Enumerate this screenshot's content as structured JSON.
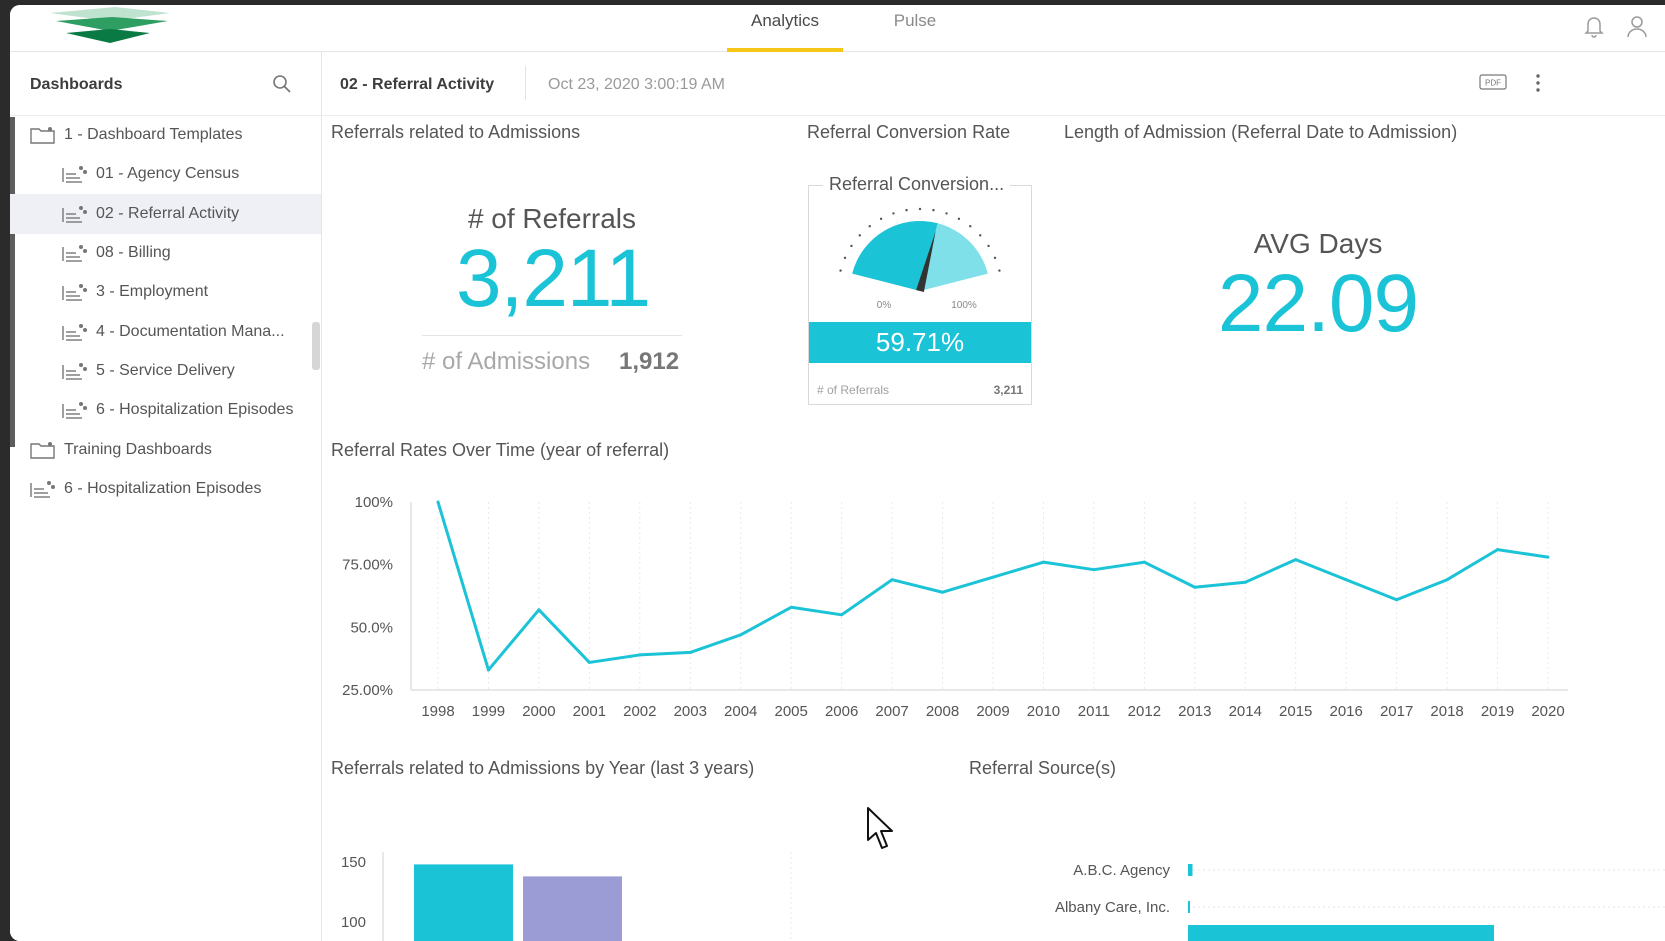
{
  "nav": {
    "tabs": [
      {
        "label": "Analytics",
        "active": true
      },
      {
        "label": "Pulse",
        "active": false
      }
    ]
  },
  "sidebar": {
    "title": "Dashboards",
    "items": [
      {
        "label": "1 - Dashboard Templates",
        "type": "folder",
        "level": 0
      },
      {
        "label": "01 - Agency Census",
        "type": "dashboard",
        "level": 1
      },
      {
        "label": "02 - Referral Activity",
        "type": "dashboard",
        "level": 1,
        "selected": true
      },
      {
        "label": "08 - Billing",
        "type": "dashboard",
        "level": 1
      },
      {
        "label": "3 - Employment",
        "type": "dashboard",
        "level": 1
      },
      {
        "label": "4 - Documentation Mana...",
        "type": "dashboard",
        "level": 1
      },
      {
        "label": "5 - Service Delivery",
        "type": "dashboard",
        "level": 1
      },
      {
        "label": "6 - Hospitalization Episodes",
        "type": "dashboard",
        "level": 1
      },
      {
        "label": "Training Dashboards",
        "type": "folder",
        "level": 0
      },
      {
        "label": "6 - Hospitalization Episodes",
        "type": "dashboard",
        "level": 0
      }
    ]
  },
  "dashboard": {
    "title": "02 - Referral Activity",
    "timestamp": "Oct 23, 2020 3:00:19 AM",
    "pdf_label": "PDF"
  },
  "widgets": {
    "referrals_title": "Referrals related to Admissions",
    "referrals_caption": "# of Referrals",
    "referrals_value": "3,211",
    "admissions_caption": "# of Admissions",
    "admissions_value": "1,912",
    "conversion_title": "Referral Conversion Rate",
    "gauge_title": "Referral Conversion...",
    "gauge_min": "0%",
    "gauge_max": "100%",
    "gauge_value": "59.71%",
    "gauge_fraction": 0.5971,
    "gauge_foot_label": "# of Referrals",
    "gauge_foot_value": "3,211",
    "length_title": "Length of Admission (Referral Date to Admission)",
    "avg_caption": "AVG Days",
    "avg_value": "22.09",
    "rates_title": "Referral Rates Over Time (year of referral)",
    "byyear_title": "Referrals related to Admissions by Year (last 3 years)",
    "sources_title": "Referral Source(s)"
  },
  "colors": {
    "accent": "#1bc3d7",
    "accent_light": "#7fe0ea",
    "purple": "#9b9bd6",
    "tab_underline": "#f5c518"
  },
  "chart_data": [
    {
      "type": "line",
      "x": [
        "1998",
        "1999",
        "2000",
        "2001",
        "2002",
        "2003",
        "2004",
        "2005",
        "2006",
        "2007",
        "2008",
        "2009",
        "2010",
        "2011",
        "2012",
        "2013",
        "2014",
        "2015",
        "2016",
        "2017",
        "2018",
        "2019",
        "2020"
      ],
      "series": [
        {
          "values": [
            100,
            33,
            57,
            36,
            39,
            40,
            47,
            58,
            55,
            69,
            64,
            70,
            76,
            73,
            76,
            66,
            68,
            77,
            69,
            61,
            69,
            81,
            78
          ]
        }
      ],
      "yticks": [
        "100%",
        "75.00%",
        "50.0%",
        "25.00%"
      ],
      "ylim": [
        25,
        100
      ],
      "grid": "vertical"
    },
    {
      "type": "bar",
      "series": [
        {
          "values": [
            148
          ]
        },
        {
          "values": [
            138
          ]
        }
      ],
      "yticks": [
        "150",
        "100"
      ]
    },
    {
      "type": "bar",
      "orientation": "horizontal",
      "categories": [
        "A.B.C. Agency",
        "Albany Care, Inc."
      ],
      "values": [
        1.5,
        0.5
      ]
    }
  ]
}
